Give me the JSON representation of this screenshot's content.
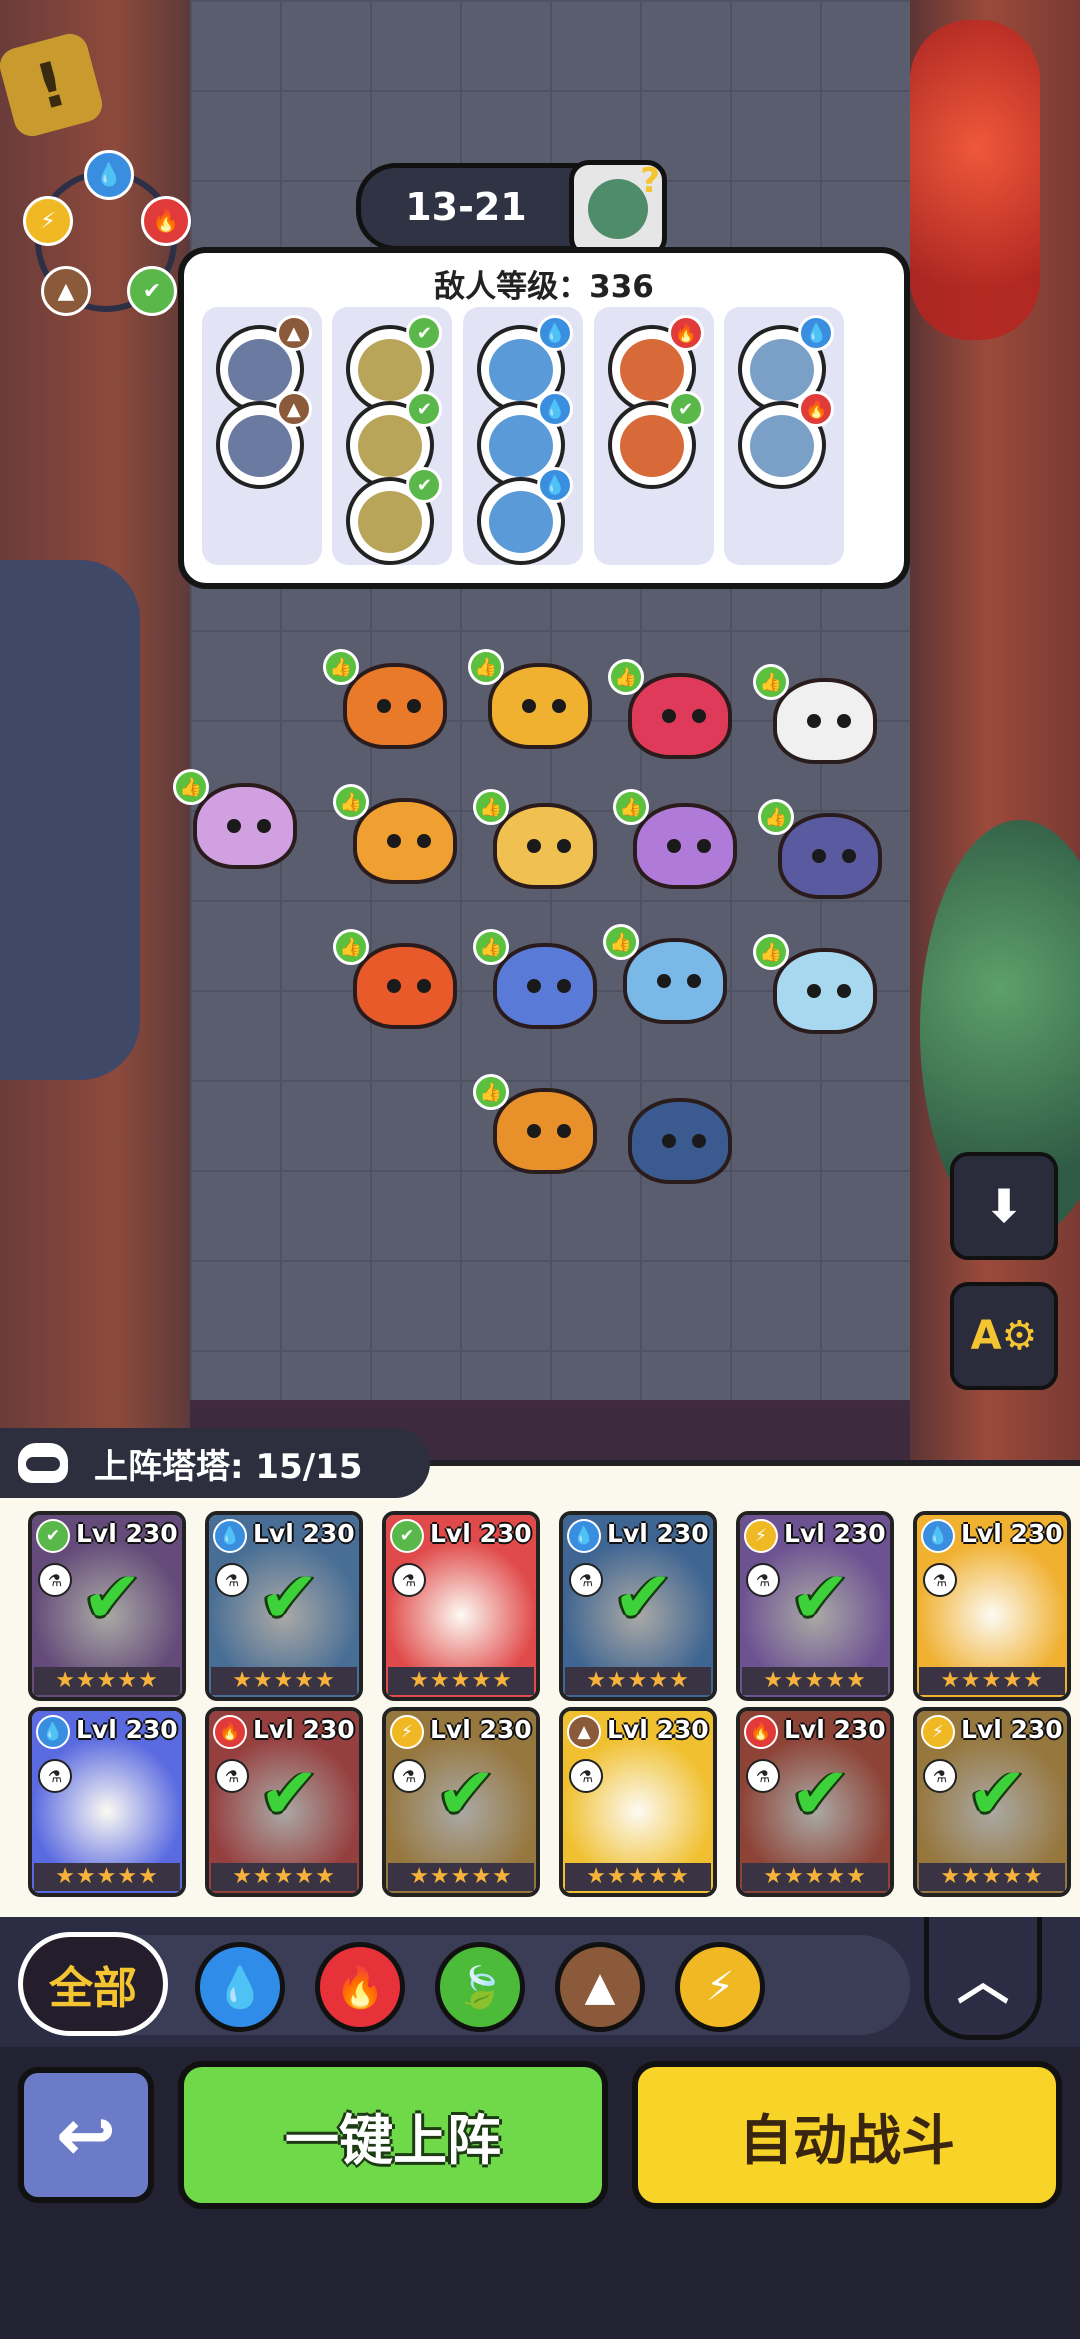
{
  "stage": {
    "number": "13-21",
    "boss_icon": "zombie-boss-question-icon"
  },
  "enemy_panel": {
    "label": "敌人等级：",
    "level": "336",
    "columns": [
      {
        "enemies": [
          {
            "element": "earth",
            "color": "#8a5a3a"
          },
          {
            "element": "earth",
            "color": "#8a5a3a"
          }
        ]
      },
      {
        "enemies": [
          {
            "element": "leaf",
            "color": "#5ab84a"
          },
          {
            "element": "leaf",
            "color": "#5ab84a"
          },
          {
            "element": "leaf",
            "color": "#5ab84a"
          }
        ]
      },
      {
        "enemies": [
          {
            "element": "water",
            "color": "#3a8ee0"
          },
          {
            "element": "water",
            "color": "#3a8ee0"
          },
          {
            "element": "water",
            "color": "#3a8ee0"
          }
        ]
      },
      {
        "enemies": [
          {
            "element": "fire",
            "color": "#e03a3a"
          },
          {
            "element": "leaf",
            "color": "#5ab84a"
          }
        ]
      },
      {
        "enemies": [
          {
            "element": "water",
            "color": "#3a8ee0"
          },
          {
            "element": "fire",
            "color": "#e03a3a"
          }
        ]
      }
    ]
  },
  "roster": {
    "label": "上阵塔塔: 15/15",
    "cards": [
      {
        "level": "Lvl 230",
        "element": "leaf",
        "bg": "#7d4fa3",
        "dim": true,
        "stars": "★★★★★"
      },
      {
        "level": "Lvl 230",
        "element": "water",
        "bg": "#4a8fd6",
        "dim": true,
        "stars": "★★★★★"
      },
      {
        "level": "Lvl 230",
        "element": "leaf",
        "bg": "#e04a4a",
        "dim": false,
        "stars": "★★★★★"
      },
      {
        "level": "Lvl 230",
        "element": "water",
        "bg": "#3a7fd0",
        "dim": true,
        "stars": "★★★★★"
      },
      {
        "level": "Lvl 230",
        "element": "lightning",
        "bg": "#8c5bd0",
        "dim": true,
        "stars": "★★★★★"
      },
      {
        "level": "Lvl 230",
        "element": "water",
        "bg": "#f0b030",
        "dim": false,
        "stars": "★★★★★"
      },
      {
        "level": "Lvl 230",
        "element": "water",
        "bg": "#5a6ae0",
        "dim": false,
        "stars": "★★★★★"
      },
      {
        "level": "Lvl 230",
        "element": "fire",
        "bg": "#d83a3a",
        "dim": true,
        "stars": "★★★★★"
      },
      {
        "level": "Lvl 230",
        "element": "lightning",
        "bg": "#d8a03a",
        "dim": true,
        "stars": "★★★★★"
      },
      {
        "level": "Lvl 230",
        "element": "earth",
        "bg": "#f0c030",
        "dim": false,
        "stars": "★★★★★"
      },
      {
        "level": "Lvl 230",
        "element": "fire",
        "bg": "#c8402a",
        "dim": true,
        "stars": "★★★★★"
      },
      {
        "level": "Lvl 230",
        "element": "lightning",
        "bg": "#d8a03a",
        "dim": true,
        "stars": "★★★★★"
      }
    ]
  },
  "filters": {
    "all_label": "全部",
    "buttons": [
      {
        "name": "water-filter-button",
        "icon": "💧",
        "color": "#2f8ce8"
      },
      {
        "name": "fire-filter-button",
        "icon": "🔥",
        "color": "#e8323a"
      },
      {
        "name": "leaf-filter-button",
        "icon": "🍃",
        "color": "#4cbb3a"
      },
      {
        "name": "earth-filter-button",
        "icon": "▲",
        "color": "#8a5a3a"
      },
      {
        "name": "lightning-filter-button",
        "icon": "⚡",
        "color": "#f0b822"
      }
    ],
    "collapse_icon": "︿"
  },
  "actions": {
    "back_icon": "↩",
    "deploy_label": "一键上阵",
    "auto_label": "自动战斗"
  },
  "side_buttons": {
    "save_icon": "⬇",
    "auto_setting_label": "A⚙"
  },
  "colors": {
    "water": "#3a8ee0",
    "fire": "#e03a3a",
    "leaf": "#5ab84a",
    "earth": "#8a5a3a",
    "lightning": "#f0b822"
  }
}
